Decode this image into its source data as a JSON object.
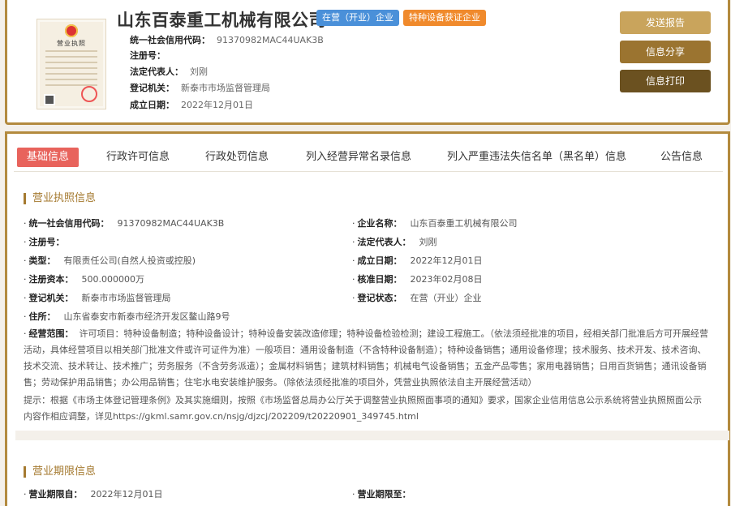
{
  "header": {
    "company_name": "山东百泰重工机械有限公司",
    "badges": {
      "status": "在营（开业）企业",
      "special": "特种设备获证企业"
    },
    "license_image": {
      "title": "营业执照"
    },
    "rows": [
      {
        "label": "统一社会信用代码：",
        "value": "91370982MAC44UAK3B"
      },
      {
        "label": "注册号：",
        "value": ""
      },
      {
        "label": "法定代表人：",
        "value": "刘刚"
      },
      {
        "label": "登记机关：",
        "value": "新泰市市场监督管理局"
      },
      {
        "label": "成立日期：",
        "value": "2022年12月01日"
      }
    ],
    "buttons": {
      "report": "发送报告",
      "share": "信息分享",
      "print": "信息打印"
    }
  },
  "tabs": [
    "基础信息",
    "行政许可信息",
    "行政处罚信息",
    "列入经营异常名录信息",
    "列入严重违法失信名单（黑名单）信息",
    "公告信息"
  ],
  "license_section": {
    "title": "营业执照信息",
    "left": [
      {
        "label": "统一社会信用代码：",
        "value": "91370982MAC44UAK3B"
      },
      {
        "label": "注册号：",
        "value": ""
      },
      {
        "label": "类型：",
        "value": "有限责任公司(自然人投资或控股)"
      },
      {
        "label": "注册资本：",
        "value": "500.000000万"
      },
      {
        "label": "登记机关：",
        "value": "新泰市市场监督管理局"
      },
      {
        "label": "住所：",
        "value": "山东省泰安市新泰市经济开发区鳌山路9号"
      }
    ],
    "right": [
      {
        "label": "企业名称：",
        "value": "山东百泰重工机械有限公司"
      },
      {
        "label": "法定代表人：",
        "value": "刘刚"
      },
      {
        "label": "成立日期：",
        "value": "2022年12月01日"
      },
      {
        "label": "核准日期：",
        "value": "2023年02月08日"
      },
      {
        "label": "登记状态：",
        "value": "在营（开业）企业"
      }
    ],
    "scope_label": "经营范围：",
    "scope_value": "许可项目：特种设备制造；特种设备设计；特种设备安装改造修理；特种设备检验检测；建设工程施工。（依法须经批准的项目，经相关部门批准后方可开展经营活动，具体经营项目以相关部门批准文件或许可证件为准）一般项目：通用设备制造（不含特种设备制造）；特种设备销售；通用设备修理；技术服务、技术开发、技术咨询、技术交流、技术转让、技术推广；劳务服务（不含劳务派遣）；金属材料销售；建筑材料销售；机械电气设备销售；五金产品零售；家用电器销售；日用百货销售；通讯设备销售；劳动保护用品销售；办公用品销售；住宅水电安装维护服务。（除依法须经批准的项目外，凭营业执照依法自主开展经营活动）",
    "notice": "提示：根据《市场主体登记管理条例》及其实施细则，按照《市场监督总局办公厅关于调整营业执照照面事项的通知》要求，国家企业信用信息公示系统将营业执照照面公示内容作相应调整，详见https://gkml.samr.gov.cn/nsjg/djzcj/202209/t20220901_349745.html"
  },
  "term_section": {
    "title": "营业期限信息",
    "from_label": "营业期限自：",
    "from_value": "2022年12月01日",
    "to_label": "营业期限至：",
    "to_value": ""
  },
  "colors": {
    "gold": "#b38a3e",
    "active_tab": "#e8635c",
    "badge_blue": "#4a90d9",
    "badge_orange": "#f08a2c"
  }
}
